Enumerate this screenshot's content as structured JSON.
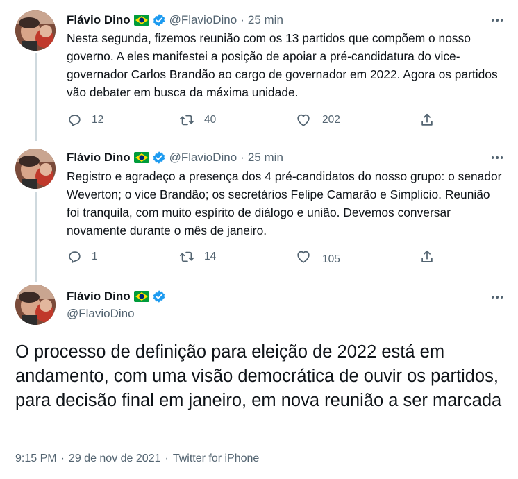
{
  "author": {
    "name": "Flávio Dino",
    "handle": "@FlavioDino"
  },
  "colors": {
    "text": "#0f1419",
    "secondary": "#536471",
    "verified": "#1d9bf0",
    "flag_green": "#009c3b",
    "flag_yellow": "#ffdf00",
    "flag_blue": "#002776"
  },
  "tweets": [
    {
      "time": "25 min",
      "separator": "·",
      "text": "Nesta segunda, fizemos reunião com os 13 partidos que compõem o nosso governo. A eles manifestei a posição de apoiar a pré-candidatura do vice-governador Carlos Brandão ao cargo de governador em 2022. Agora os partidos vão debater em busca da máxima unidade.",
      "replies": "12",
      "retweets": "40",
      "likes": "202"
    },
    {
      "time": "25 min",
      "separator": "·",
      "text": "Registro e agradeço a presença dos 4 pré-candidatos do nosso grupo: o senador Weverton; o vice Brandão; os secretários Felipe Camarão e Simplicio. Reunião foi tranquila, com muito espírito de diálogo e união. Devemos conversar novamente durante o mês de janeiro.",
      "replies": "1",
      "retweets": "14",
      "likes": "105"
    }
  ],
  "main_tweet": {
    "text": "O processo de definição para eleição de 2022 está em andamento, com uma visão democrática de ouvir os partidos, para decisão final em janeiro, em nova reunião a ser marcada",
    "time": "9:15 PM",
    "date": "29 de nov de 2021",
    "source": "Twitter for iPhone",
    "separator": "·"
  },
  "icons": {
    "flag": "brazil-flag-icon",
    "verified": "verified-badge-icon",
    "more": "more-options-icon",
    "reply": "reply-icon",
    "retweet": "retweet-icon",
    "like": "heart-icon",
    "share": "share-icon"
  }
}
